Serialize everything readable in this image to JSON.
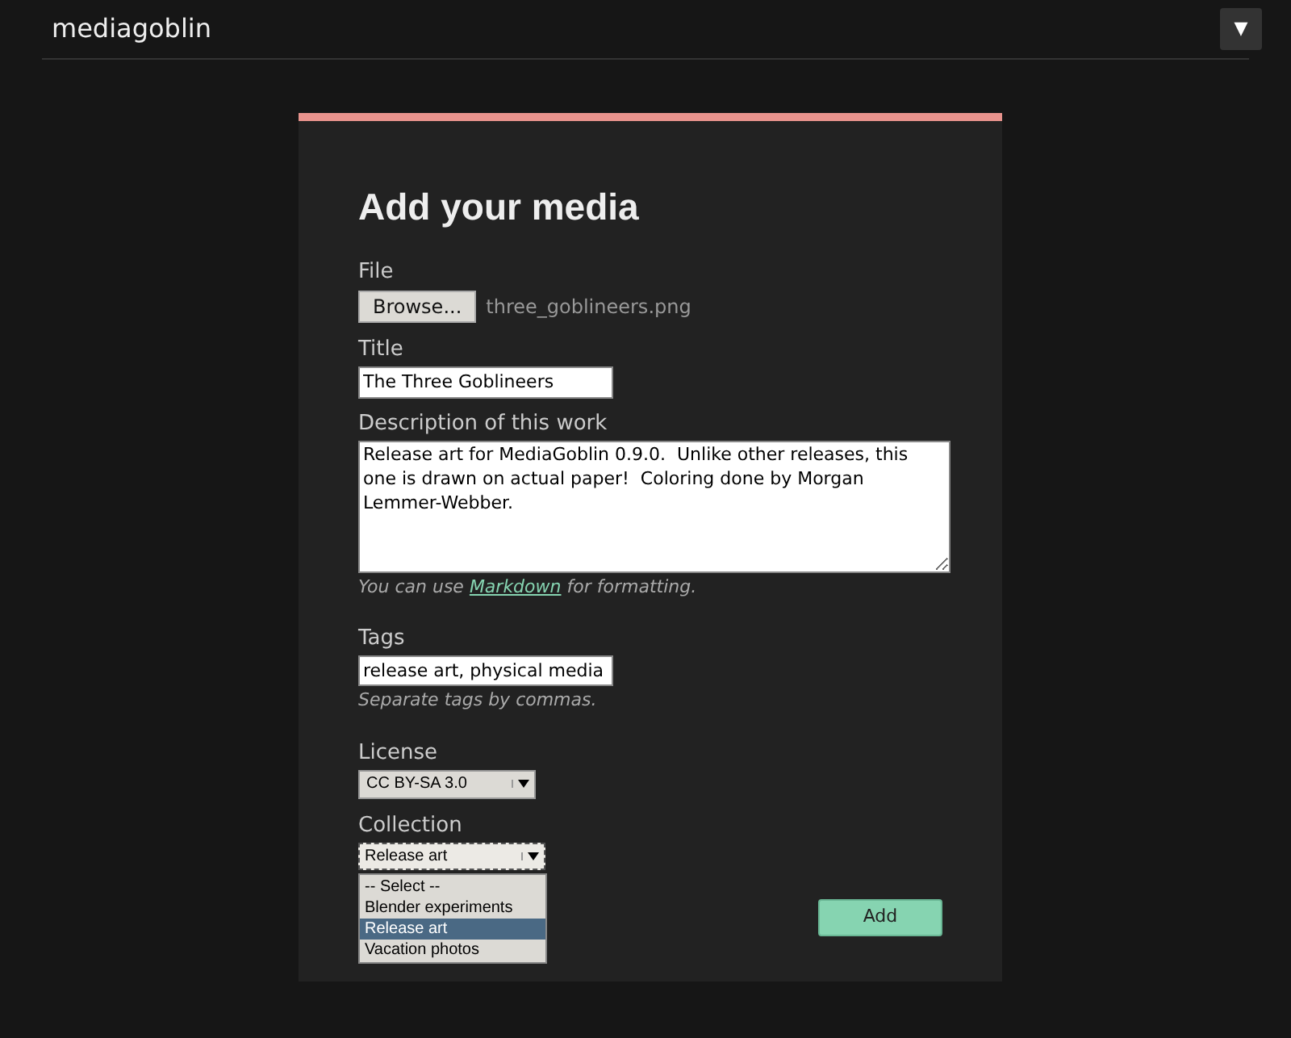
{
  "header": {
    "site_name": "mediagoblin",
    "menu_button": "▼"
  },
  "form": {
    "title": "Add your media",
    "file": {
      "label": "File",
      "button": "Browse...",
      "filename": "three_goblineers.png"
    },
    "title_field": {
      "label": "Title",
      "value": "The Three Goblineers"
    },
    "description": {
      "label": "Description of this work",
      "value": "Release art for MediaGoblin 0.9.0.  Unlike other releases, this one is drawn on actual paper!  Coloring done by Morgan Lemmer-Webber.",
      "hint_before": "You can use",
      "hint_link": "Markdown",
      "hint_after": "for formatting."
    },
    "tags": {
      "label": "Tags",
      "value": "release art, physical media",
      "hint": "Separate tags by commas."
    },
    "license": {
      "label": "License",
      "value": "CC BY-SA 3.0"
    },
    "collection": {
      "label": "Collection",
      "value": "Release art",
      "expanded": true,
      "options": [
        {
          "label": "-- Select --",
          "selected": false
        },
        {
          "label": "Blender experiments",
          "selected": false
        },
        {
          "label": "Release art",
          "selected": true
        },
        {
          "label": "Vacation photos",
          "selected": false
        }
      ]
    },
    "submit": "Add"
  }
}
